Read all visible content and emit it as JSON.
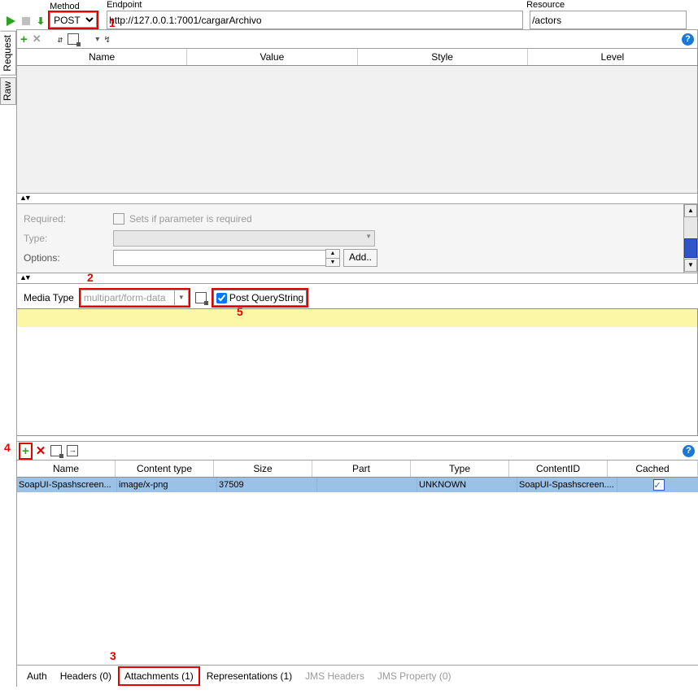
{
  "top": {
    "method_label": "Method",
    "method_value": "POST",
    "endpoint_label": "Endpoint",
    "endpoint_value": "http://127.0.0.1:7001/cargarArchivo",
    "resource_label": "Resource",
    "resource_value": "/actors"
  },
  "callouts": {
    "c1": "1",
    "c2": "2",
    "c3": "3",
    "c4": "4",
    "c5": "5"
  },
  "vtabs": {
    "request": "Request",
    "raw": "Raw"
  },
  "param_head": {
    "name": "Name",
    "value": "Value",
    "style": "Style",
    "level": "Level"
  },
  "detail": {
    "required_label": "Required:",
    "required_hint": "Sets if parameter is required",
    "type_label": "Type:",
    "options_label": "Options:",
    "add_btn": "Add.."
  },
  "media": {
    "label": "Media Type",
    "value": "multipart/form-data",
    "post_qs": "Post QueryString"
  },
  "att_head": {
    "name": "Name",
    "ct": "Content type",
    "size": "Size",
    "part": "Part",
    "type": "Type",
    "cid": "ContentID",
    "cached": "Cached"
  },
  "attachments": [
    {
      "name": "SoapUI-Spashscreen...",
      "ct": "image/x-png",
      "size": "37509",
      "part": "",
      "type": "UNKNOWN",
      "cid": "SoapUI-Spashscreen....",
      "cached": true
    }
  ],
  "btabs": {
    "auth": "Auth",
    "headers": "Headers (0)",
    "attachments": "Attachments (1)",
    "reps": "Representations (1)",
    "jms_h": "JMS Headers",
    "jms_p": "JMS Property (0)"
  },
  "help": "?"
}
